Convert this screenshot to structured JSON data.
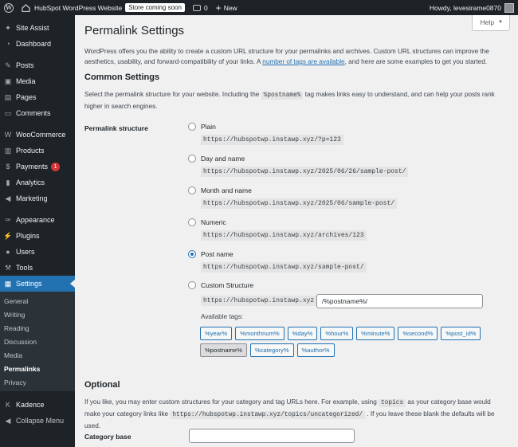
{
  "adminbar": {
    "site_name": "HubSpot WordPress Website",
    "store_badge": "Store coming soon",
    "comments_count": "0",
    "new_label": "New",
    "howdy": "Howdy, levesirame0870"
  },
  "sidebar": {
    "items": [
      {
        "label": "Site Assist",
        "icon": "site-assist-icon"
      },
      {
        "label": "Dashboard",
        "icon": "dashboard-icon"
      },
      {
        "label": "Posts",
        "icon": "pin-icon"
      },
      {
        "label": "Media",
        "icon": "media-icon"
      },
      {
        "label": "Pages",
        "icon": "pages-icon"
      },
      {
        "label": "Comments",
        "icon": "comments-icon"
      },
      {
        "label": "WooCommerce",
        "icon": "woocommerce-icon"
      },
      {
        "label": "Products",
        "icon": "products-icon"
      },
      {
        "label": "Payments",
        "icon": "payments-icon",
        "badge": "1"
      },
      {
        "label": "Analytics",
        "icon": "analytics-icon"
      },
      {
        "label": "Marketing",
        "icon": "marketing-icon"
      },
      {
        "label": "Appearance",
        "icon": "appearance-icon"
      },
      {
        "label": "Plugins",
        "icon": "plugins-icon"
      },
      {
        "label": "Users",
        "icon": "users-icon"
      },
      {
        "label": "Tools",
        "icon": "tools-icon"
      },
      {
        "label": "Settings",
        "icon": "settings-icon"
      },
      {
        "label": "Kadence",
        "icon": "kadence-icon"
      },
      {
        "label": "Collapse Menu",
        "icon": "collapse-icon"
      }
    ],
    "settings_sub": [
      "General",
      "Writing",
      "Reading",
      "Discussion",
      "Media",
      "Permalinks",
      "Privacy"
    ]
  },
  "help_label": "Help",
  "page_title": "Permalink Settings",
  "intro": {
    "before": "WordPress offers you the ability to create a custom URL structure for your permalinks and archives. Custom URL structures can improve the aesthetics, usability, and forward-compatibility of your links. A ",
    "link": "number of tags are available",
    "after": ", and here are some examples to get you started."
  },
  "common": {
    "heading": "Common Settings",
    "desc_before": "Select the permalink structure for your website. Including the ",
    "desc_code": "%postname%",
    "desc_after": " tag makes links easy to understand, and can help your posts rank higher in search engines.",
    "structure_label": "Permalink structure",
    "options": [
      {
        "label": "Plain",
        "example": "https://hubspotwp.instawp.xyz/?p=123",
        "checked": false
      },
      {
        "label": "Day and name",
        "example": "https://hubspotwp.instawp.xyz/2025/06/26/sample-post/",
        "checked": false
      },
      {
        "label": "Month and name",
        "example": "https://hubspotwp.instawp.xyz/2025/06/sample-post/",
        "checked": false
      },
      {
        "label": "Numeric",
        "example": "https://hubspotwp.instawp.xyz/archives/123",
        "checked": false
      },
      {
        "label": "Post name",
        "example": "https://hubspotwp.instawp.xyz/sample-post/",
        "checked": true
      },
      {
        "label": "Custom Structure",
        "checked": false
      }
    ],
    "custom_base": "https://hubspotwp.instawp.xyz",
    "custom_value": "/%postname%/",
    "available_tags_label": "Available tags:",
    "tags": [
      "%year%",
      "%monthnum%",
      "%day%",
      "%hour%",
      "%minute%",
      "%second%",
      "%post_id%",
      "%postname%",
      "%category%",
      "%author%"
    ],
    "active_tag": "%postname%"
  },
  "optional": {
    "heading": "Optional",
    "desc_before": "If you like, you may enter custom structures for your category and tag URLs here. For example, using ",
    "desc_code1": "topics",
    "desc_mid": " as your category base would make your category links like ",
    "desc_code2": "https://hubspotwp.instawp.xyz/topics/uncategorized/",
    "desc_after": " . If you leave these blank the defaults will be used.",
    "category_base_label": "Category base"
  }
}
